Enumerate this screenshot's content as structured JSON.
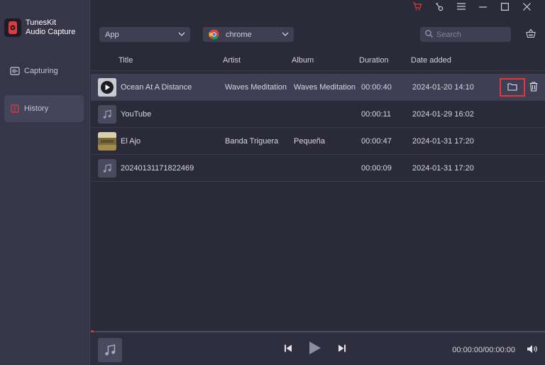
{
  "app": {
    "name_line1": "TunesKit",
    "name_line2": "Audio Capture"
  },
  "sidebar": {
    "items": [
      {
        "label": "Capturing",
        "icon": "capture-icon"
      },
      {
        "label": "History",
        "icon": "history-icon",
        "selected": true
      }
    ]
  },
  "filters": {
    "app_dropdown": "App",
    "browser_dropdown": "chrome",
    "search_placeholder": "Search"
  },
  "table": {
    "headers": [
      "Title",
      "Artist",
      "Album",
      "Duration",
      "Date added"
    ],
    "rows": [
      {
        "title": "Ocean At A Distance",
        "artist": "Waves Meditation",
        "album": "Waves Meditation",
        "duration": "00:00:40",
        "date": "2024-01-20 14:10",
        "thumb": "ocean-cover"
      },
      {
        "title": "YouTube",
        "artist": "",
        "album": "",
        "duration": "00:00:11",
        "date": "2024-01-29 16:02",
        "thumb": "music-note"
      },
      {
        "title": "El Ajo",
        "artist": "Banda Triguera",
        "album": "Pequeña",
        "duration": "00:00:47",
        "date": "2024-01-31 17:20",
        "thumb": "eljo-cover"
      },
      {
        "title": "20240131171822469",
        "artist": "",
        "album": "",
        "duration": "00:00:09",
        "date": "2024-01-31 17:20",
        "thumb": "music-note"
      }
    ]
  },
  "player": {
    "time": "00:00:00/00:00:00",
    "progress": 0
  },
  "colors": {
    "accent": "#e0393f",
    "sidebar": "#373649",
    "background": "#2b2a38"
  }
}
